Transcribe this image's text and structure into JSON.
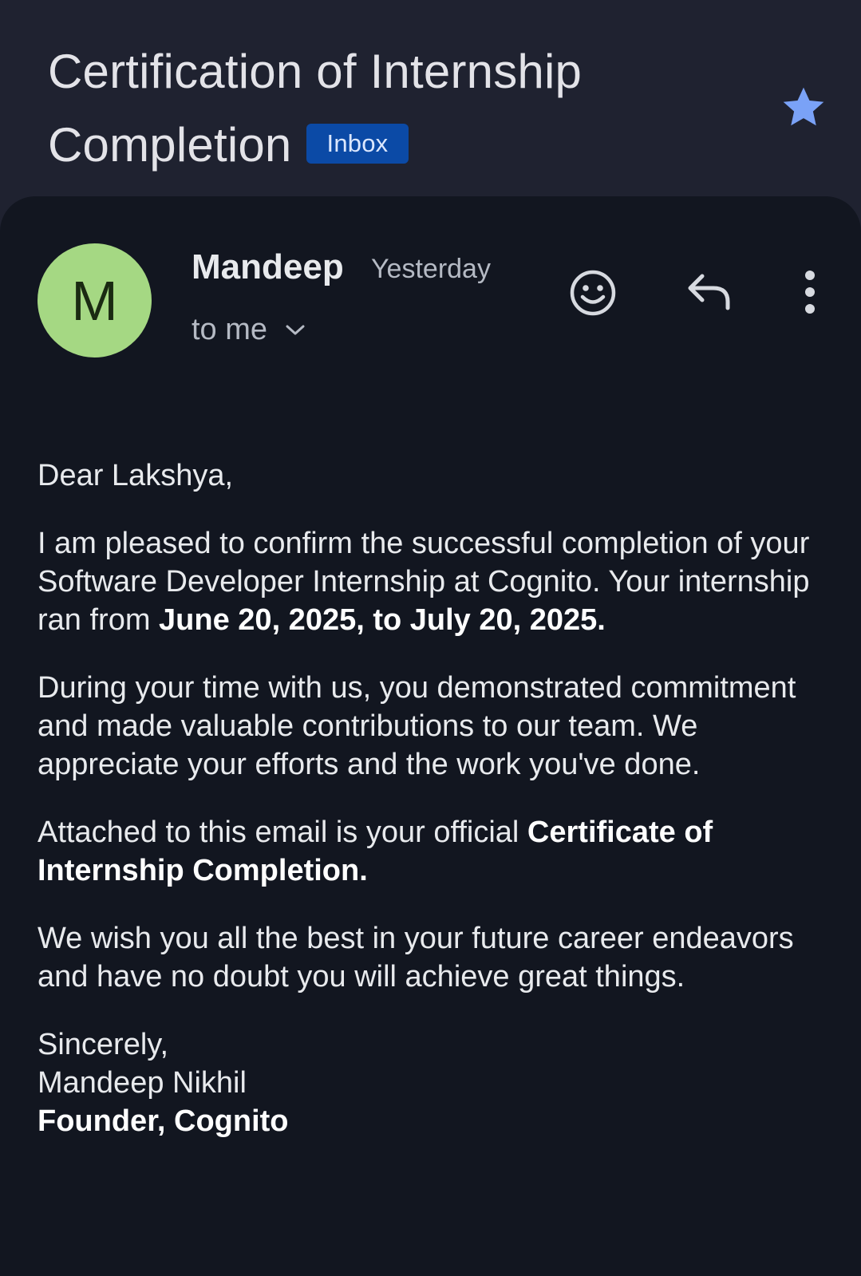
{
  "email": {
    "subject_line1": "Certification of Internship",
    "subject_line2": "Completion",
    "label": "Inbox",
    "starred": true,
    "star_color": "#7aa2f7"
  },
  "sender": {
    "avatar_letter": "M",
    "avatar_color": "#a5d883",
    "name": "Mandeep",
    "time": "Yesterday",
    "recipient": "to me"
  },
  "actions": {
    "emoji_icon": "emoji-reaction-icon",
    "reply_icon": "reply-icon",
    "more_icon": "more-vert-icon"
  },
  "body": {
    "greeting": "Dear Lakshya,",
    "p1_text": "I am pleased to confirm the successful completion of your Software Developer Internship at Cognito. Your internship ran from ",
    "p1_bold": "June 20, 2025, to July 20, 2025.",
    "p2": "During your time with us, you demonstrated commitment and made valuable contributions to our team. We appreciate your efforts and the work you've done.",
    "p3_text": "Attached to this email is your official ",
    "p3_bold": "Certificate of Internship Completion.",
    "p4": "We wish you all the best in your future career endeavors and have no doubt you will achieve great things.",
    "closing": "Sincerely,",
    "signer_name": "Mandeep Nikhil",
    "signer_title": "Founder, Cognito"
  }
}
